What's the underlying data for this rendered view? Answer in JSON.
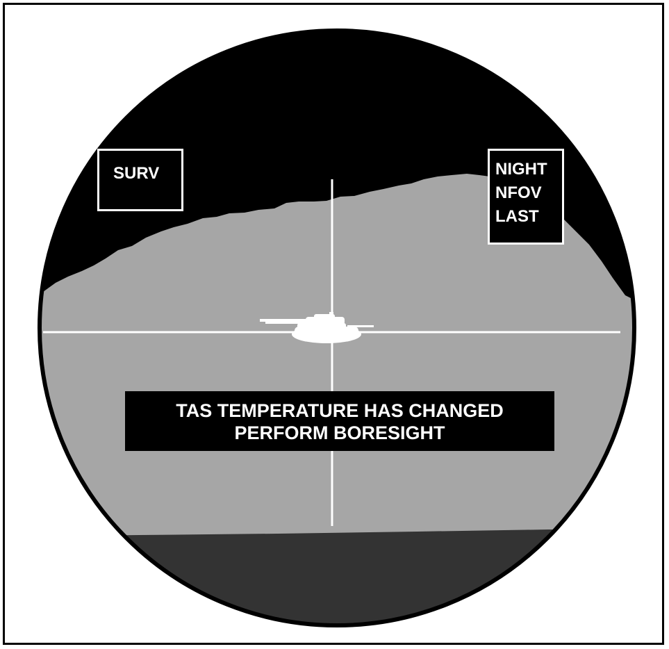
{
  "display": {
    "mode_label": "SURV",
    "status_lines": [
      "NIGHT",
      "NFOV",
      "LAST"
    ],
    "message_lines": [
      "TAS TEMPERATURE HAS CHANGED",
      "PERFORM BORESIGHT"
    ]
  },
  "icons": {
    "reticle": "crosshair-icon",
    "target": "tank-icon"
  },
  "colors": {
    "sky": "#000000",
    "terrain": "#a6a6a6",
    "foreground": "#333333",
    "symbology": "#ffffff"
  }
}
